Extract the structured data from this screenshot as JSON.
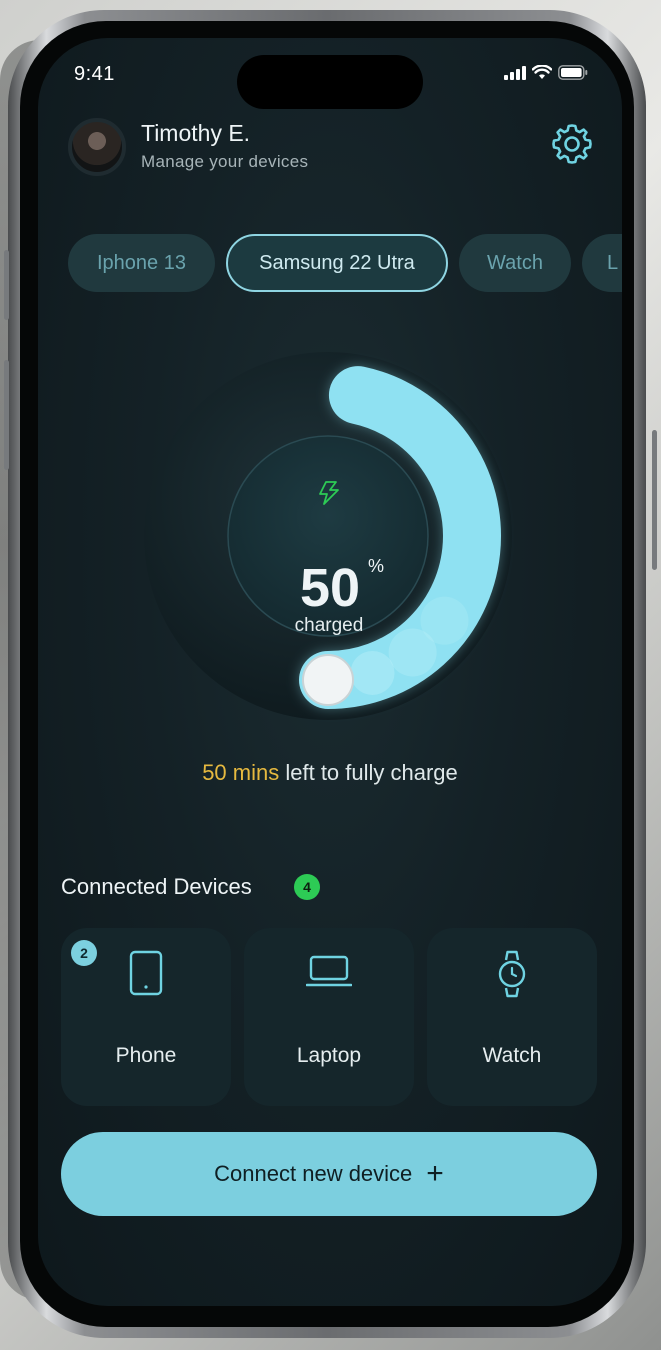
{
  "status": {
    "time": "9:41"
  },
  "user": {
    "name": "Timothy E.",
    "subtitle": "Manage your devices"
  },
  "tabs": [
    {
      "label": "Iphone 13",
      "active": false
    },
    {
      "label": "Samsung 22 Utra",
      "active": true
    },
    {
      "label": "Watch",
      "active": false
    },
    {
      "label": "L",
      "active": false
    }
  ],
  "charge": {
    "percent_value": "50",
    "percent_sign": "%",
    "caption": "charged",
    "level": 0.5
  },
  "time_left": {
    "highlight": "50 mins",
    "rest": "left to fully charge"
  },
  "connected": {
    "title": "Connected Devices",
    "count": "4",
    "devices": [
      {
        "label": "Phone",
        "icon": "phone-icon",
        "badge": "2"
      },
      {
        "label": "Laptop",
        "icon": "laptop-icon"
      },
      {
        "label": "Watch",
        "icon": "watch-icon"
      }
    ]
  },
  "cta": {
    "label": "Connect new device",
    "icon": "plus-icon"
  },
  "colors": {
    "accent": "#7ccfdf",
    "arc": "#8fe1f2",
    "highlight": "#e6b93f",
    "badge_green": "#2dcb55"
  }
}
